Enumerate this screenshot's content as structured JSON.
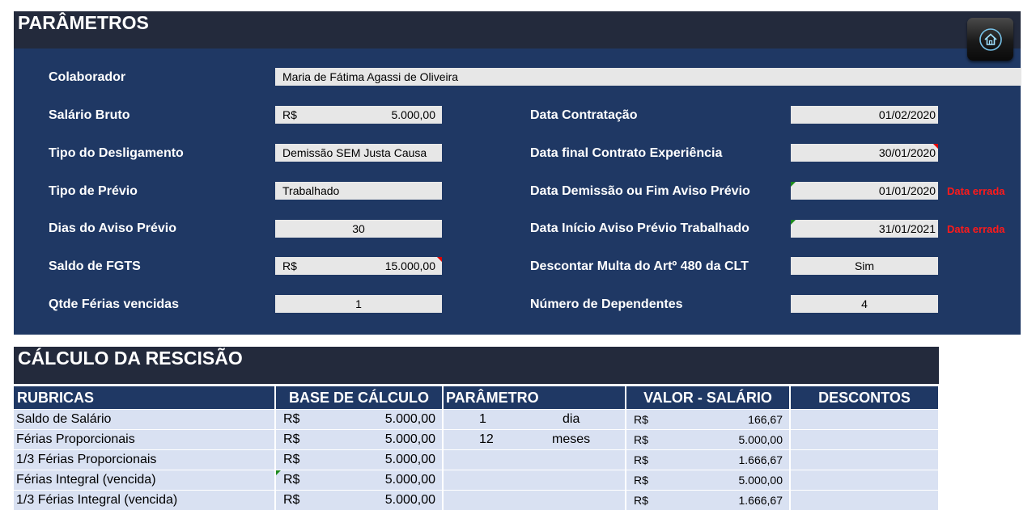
{
  "params": {
    "title": "PARÂMETROS",
    "home_icon": "home-icon",
    "colaborador": {
      "label": "Colaborador",
      "value": "Maria de Fátima Agassi de Oliveira"
    },
    "salario_bruto": {
      "label": "Salário Bruto",
      "currency": "R$",
      "value": "5.000,00"
    },
    "tipo_desligamento": {
      "label": "Tipo do Desligamento",
      "value": "Demissão SEM Justa Causa"
    },
    "tipo_previo": {
      "label": "Tipo de Prévio",
      "value": "Trabalhado"
    },
    "dias_aviso": {
      "label": "Dias do Aviso Prévio",
      "value": "30"
    },
    "saldo_fgts": {
      "label": "Saldo de FGTS",
      "currency": "R$",
      "value": "15.000,00"
    },
    "ferias_vencidas": {
      "label": "Qtde  Férias vencidas",
      "value": "1"
    },
    "data_contratacao": {
      "label": "Data Contratação",
      "value": "01/02/2020"
    },
    "data_final_experiencia": {
      "label": "Data  final Contrato  Experiência",
      "value": "30/01/2020"
    },
    "data_demissao": {
      "label": "Data  Demissão ou Fim  Aviso Prévio",
      "value": "01/01/2020",
      "error": "Data errada"
    },
    "data_inicio_aviso": {
      "label": "Data  Início Aviso Prévio Trabalhado",
      "value": "31/01/2021",
      "error": "Data errada"
    },
    "descontar_multa": {
      "label": "Descontar Multa do Artº 480 da CLT",
      "value": "Sim"
    },
    "num_dependentes": {
      "label": "Número de Dependentes",
      "value": "4"
    }
  },
  "calc": {
    "title": "CÁLCULO   DA   RESCISÃO",
    "headers": [
      "RUBRICAS",
      "BASE DE CÁLCULO",
      "PARÂMETRO",
      "VALOR -  SALÁRIO",
      "DESCONTOS"
    ],
    "rows": [
      {
        "rubrica": "Saldo de Salário",
        "base_cur": "R$",
        "base": "5.000,00",
        "param_n": "1",
        "param_u": "dia",
        "valor_cur": "R$",
        "valor": "166,67",
        "desconto": ""
      },
      {
        "rubrica": "Férias Proporcionais",
        "base_cur": "R$",
        "base": "5.000,00",
        "param_n": "12",
        "param_u": "meses",
        "valor_cur": "R$",
        "valor": "5.000,00",
        "desconto": ""
      },
      {
        "rubrica": "1/3 Férias Proporcionais",
        "base_cur": "R$",
        "base": "5.000,00",
        "param_n": "",
        "param_u": "",
        "valor_cur": "R$",
        "valor": "1.666,67",
        "desconto": ""
      },
      {
        "rubrica": "Férias Integral (vencida)",
        "base_cur": "R$",
        "base": "5.000,00",
        "param_n": "",
        "param_u": "",
        "valor_cur": "R$",
        "valor": "5.000,00",
        "desconto": ""
      },
      {
        "rubrica": "1/3 Férias Integral (vencida)",
        "base_cur": "R$",
        "base": "5.000,00",
        "param_n": "",
        "param_u": "",
        "valor_cur": "R$",
        "valor": "1.666,67",
        "desconto": ""
      }
    ]
  },
  "colors": {
    "panel": "#1f3864",
    "header_bar": "#232a3c",
    "field": "#e7e7e7",
    "row": "#d9e1f2",
    "error": "#ff1a1a"
  }
}
